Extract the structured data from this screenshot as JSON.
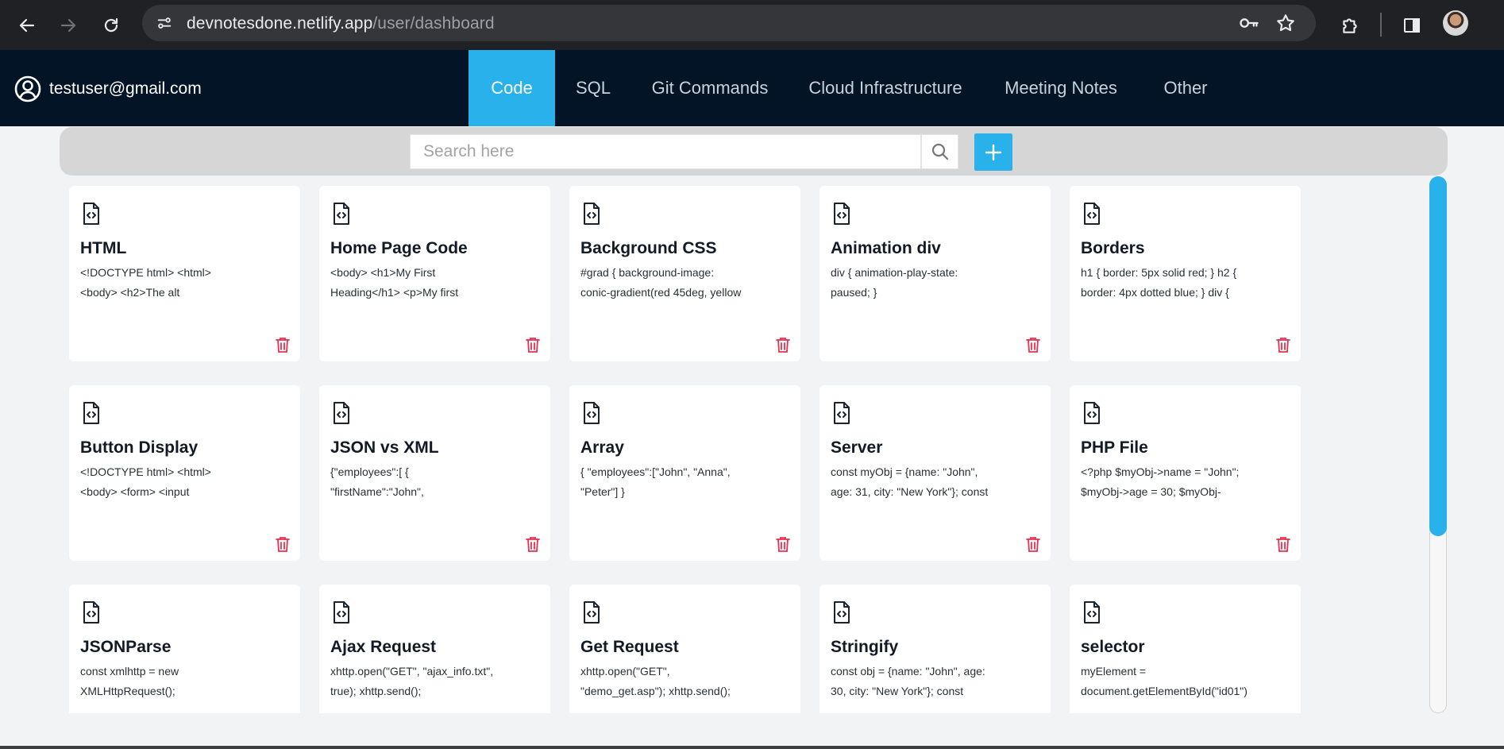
{
  "browser": {
    "url_host": "devnotesdone.netlify.app",
    "url_path": "/user/dashboard"
  },
  "header": {
    "user_email": "testuser@gmail.com",
    "tabs": [
      {
        "label": "Code",
        "active": true
      },
      {
        "label": "SQL",
        "active": false
      },
      {
        "label": "Git Commands",
        "active": false
      },
      {
        "label": "Cloud Infrastructure",
        "active": false
      },
      {
        "label": "Meeting Notes",
        "active": false
      },
      {
        "label": "Other",
        "active": false
      }
    ]
  },
  "search": {
    "placeholder": "Search here",
    "value": ""
  },
  "colors": {
    "accent": "#29b1ec",
    "header_bg": "#031427",
    "delete": "#e8304f"
  },
  "icons": {
    "card": "code-file-icon",
    "delete": "trash-icon",
    "search": "search-icon",
    "add": "plus-icon",
    "user": "user-circle-icon"
  },
  "cards": [
    {
      "title": "HTML",
      "line1": "<!DOCTYPE html> <html>",
      "line2": "<body> <h2>The alt"
    },
    {
      "title": "Home Page Code",
      "line1": "<body> <h1>My First",
      "line2": "Heading</h1> <p>My first"
    },
    {
      "title": "Background CSS",
      "line1": "#grad { background-image:",
      "line2": "conic-gradient(red 45deg, yellow"
    },
    {
      "title": "Animation div",
      "line1": "div { animation-play-state:",
      "line2": "paused; }"
    },
    {
      "title": "Borders",
      "line1": "h1 { border: 5px solid red; } h2 {",
      "line2": "border: 4px dotted blue; } div {"
    },
    {
      "title": "Button Display",
      "line1": "<!DOCTYPE html> <html>",
      "line2": "<body> <form> <input"
    },
    {
      "title": "JSON vs XML",
      "line1": "{\"employees\":[ {",
      "line2": "\"firstName\":\"John\","
    },
    {
      "title": "Array",
      "line1": "{ \"employees\":[\"John\", \"Anna\",",
      "line2": "\"Peter\"] }"
    },
    {
      "title": "Server",
      "line1": "const myObj = {name: \"John\",",
      "line2": "age: 31, city: \"New York\"}; const"
    },
    {
      "title": "PHP File",
      "line1": "<?php $myObj->name = \"John\";",
      "line2": "$myObj->age = 30; $myObj-"
    },
    {
      "title": "JSONParse",
      "line1": "const xmlhttp = new",
      "line2": "XMLHttpRequest();"
    },
    {
      "title": "Ajax Request",
      "line1": "xhttp.open(\"GET\", \"ajax_info.txt\",",
      "line2": "true); xhttp.send();"
    },
    {
      "title": "Get Request",
      "line1": "xhttp.open(\"GET\",",
      "line2": "\"demo_get.asp\"); xhttp.send();"
    },
    {
      "title": "Stringify",
      "line1": "const obj = {name: \"John\", age:",
      "line2": "30, city: \"New York\"}; const"
    },
    {
      "title": "selector",
      "line1": "myElement =",
      "line2": "document.getElementById(\"id01\")"
    }
  ]
}
